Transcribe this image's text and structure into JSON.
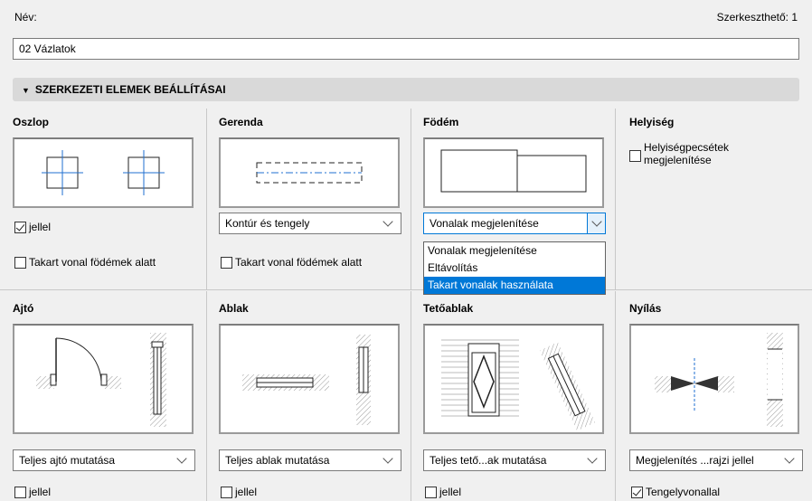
{
  "header": {
    "name_label": "Név:",
    "editable_label": "Szerkeszthető: 1",
    "name_value": "02 Vázlatok"
  },
  "section": {
    "title": "SZERKEZETI ELEMEK BEÁLLÍTÁSAI"
  },
  "columns": {
    "oszlop": {
      "title": "Oszlop",
      "checkbox1": "jellel",
      "checkbox1_checked": true,
      "checkbox2": "Takart vonal födémek alatt",
      "checkbox2_checked": false
    },
    "gerenda": {
      "title": "Gerenda",
      "select": "Kontúr és tengely",
      "checkbox2": "Takart vonal födémek alatt",
      "checkbox2_checked": false
    },
    "fodem": {
      "title": "Födém",
      "select": "Vonalak megjelenítése",
      "options": [
        "Vonalak megjelenítése",
        "Eltávolítás",
        "Takart vonalak használata"
      ],
      "highlighted_index": 2
    },
    "helyiseg": {
      "title": "Helyiség",
      "checkbox1": "Helyiségpecsétek megjelenítése",
      "checkbox1_checked": false
    },
    "ajto": {
      "title": "Ajtó",
      "select": "Teljes ajtó mutatása",
      "checkbox": "jellel",
      "checked": false
    },
    "ablak": {
      "title": "Ablak",
      "select": "Teljes ablak mutatása",
      "checkbox": "jellel",
      "checked": false
    },
    "tetoablak": {
      "title": "Tetőablak",
      "select": "Teljes tető...ak mutatása",
      "checkbox": "jellel",
      "checked": false
    },
    "nyilas": {
      "title": "Nyílás",
      "select": "Megjelenítés ...rajzi jellel",
      "checkbox": "Tengelyvonallal",
      "checked": true
    }
  },
  "colors": {
    "accent": "#0078d7",
    "section_bar": "#d9d9d9",
    "axis_blue": "#1f6fd1"
  }
}
